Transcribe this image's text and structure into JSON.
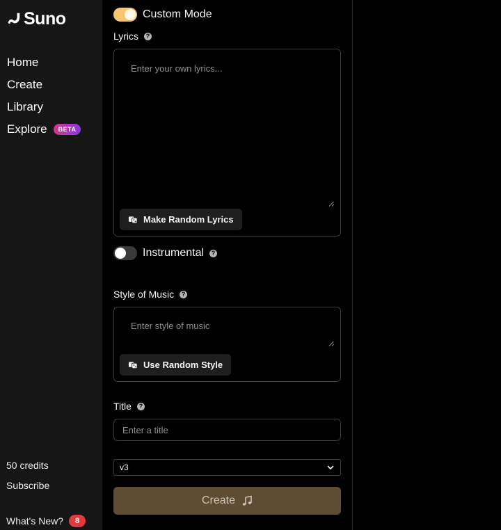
{
  "brand": {
    "name": "Suno",
    "logo_icon": "suno-wave-icon"
  },
  "sidebar": {
    "nav": [
      {
        "label": "Home"
      },
      {
        "label": "Create"
      },
      {
        "label": "Library"
      },
      {
        "label": "Explore",
        "badge": "BETA"
      }
    ],
    "credits": "50 credits",
    "subscribe": "Subscribe",
    "whats_new": {
      "label": "What's New?",
      "count": "8"
    }
  },
  "form": {
    "custom_mode": {
      "label": "Custom Mode",
      "on": true
    },
    "lyrics": {
      "label": "Lyrics",
      "placeholder": "Enter your own lyrics...",
      "random_button": "Make Random Lyrics"
    },
    "instrumental": {
      "label": "Instrumental",
      "on": false
    },
    "style": {
      "label": "Style of Music",
      "placeholder": "Enter style of music",
      "random_button": "Use Random Style"
    },
    "title": {
      "label": "Title",
      "placeholder": "Enter a title"
    },
    "model": {
      "selected": "v3"
    },
    "create_button": "Create"
  },
  "colors": {
    "accent_toggle": "#f7c470",
    "create_button": "#5e4c33",
    "beta_gradient_start": "#d9338a",
    "beta_gradient_end": "#8a3ae0",
    "badge": "#e0393e"
  }
}
